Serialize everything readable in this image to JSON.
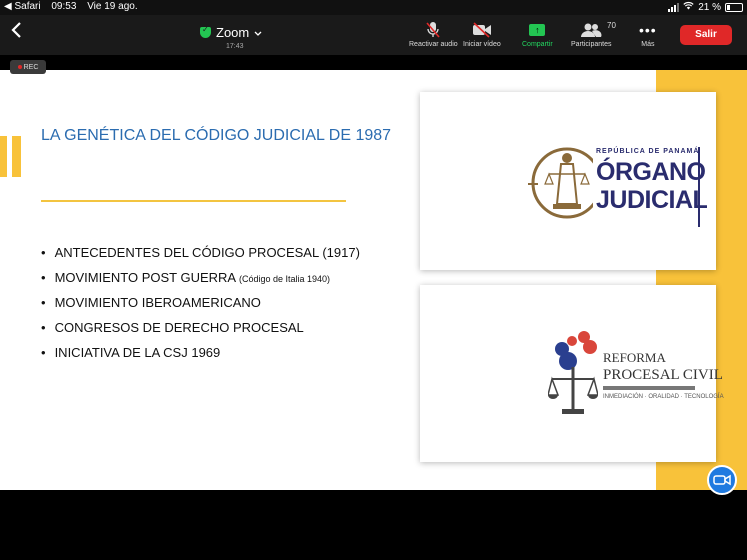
{
  "status_bar": {
    "back_app": "◀ Safari",
    "time": "09:53",
    "date": "Vie 19 ago.",
    "battery": "21 %"
  },
  "toolbar": {
    "meeting_title": "Zoom",
    "meeting_time": "17:43",
    "buttons": [
      {
        "label": "Reactivar audio",
        "icon": "muted-mic-icon"
      },
      {
        "label": "Iniciar vídeo",
        "icon": "video-off-icon"
      },
      {
        "label": "Compartir",
        "icon": "share-screen-icon"
      },
      {
        "label": "Participantes",
        "icon": "participants-icon",
        "count": "70"
      },
      {
        "label": "Más",
        "icon": "more-icon"
      }
    ],
    "leave_label": "Salir",
    "colors": {
      "accent_green": "#23c552",
      "leave_red": "#e02828"
    }
  },
  "stage": {
    "rec_label": "REC"
  },
  "slide": {
    "title": "LA GENÉTICA DEL CÓDIGO JUDICIAL DE 1987",
    "bullets": [
      {
        "text": "ANTECEDENTES DEL CÓDIGO PROCESAL (1917)",
        "note": ""
      },
      {
        "text": "MOVIMIENTO POST GUERRA ",
        "note": "(Código de Italia 1940)"
      },
      {
        "text": "MOVIMIENTO IBEROAMERICANO",
        "note": ""
      },
      {
        "text": "CONGRESOS DE DERECHO PROCESAL",
        "note": ""
      },
      {
        "text": "INICIATIVA DE LA CSJ 1969",
        "note": ""
      }
    ],
    "logo1": {
      "line1": "REPÚBLICA DE PANAMÁ",
      "line2": "ÓRGANO",
      "line3": "JUDICIAL"
    },
    "logo2": {
      "line1": "REFORMA",
      "line2": "PROCESAL CIVIL",
      "line3": "INMEDIACIÓN · ORALIDAD · TECNOLOGÍA"
    },
    "colors": {
      "accent_yellow": "#f8c23a",
      "title_blue": "#2b6cb0",
      "logo_navy": "#2a2c6e"
    }
  }
}
